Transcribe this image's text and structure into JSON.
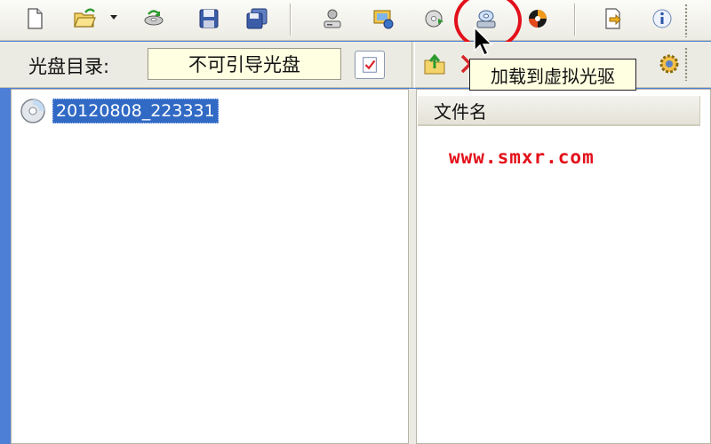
{
  "toolbar": {
    "buttons": [
      "new-file",
      "open-folder",
      "disc-burn",
      "save",
      "save-all",
      "virtual-drive",
      "disc-image",
      "convert",
      "load-to-virtual-drive",
      "burn-disc",
      "properties",
      "info"
    ]
  },
  "disc_bar": {
    "label": "光盘目录:",
    "boot_status": "不可引导光盘"
  },
  "tooltip": {
    "text": "加载到虚拟光驱"
  },
  "tree": {
    "items": [
      {
        "label": "20120808_223331",
        "icon": "cd-disc-icon",
        "selected": true
      }
    ]
  },
  "file_list": {
    "columns": [
      "文件名"
    ]
  },
  "watermark": "www.smxr.com",
  "colors": {
    "selection": "#316ac5",
    "highlight_ring": "#e2101a",
    "tooltip_bg": "#ffffe1",
    "window_frame": "#4d7fd6"
  }
}
